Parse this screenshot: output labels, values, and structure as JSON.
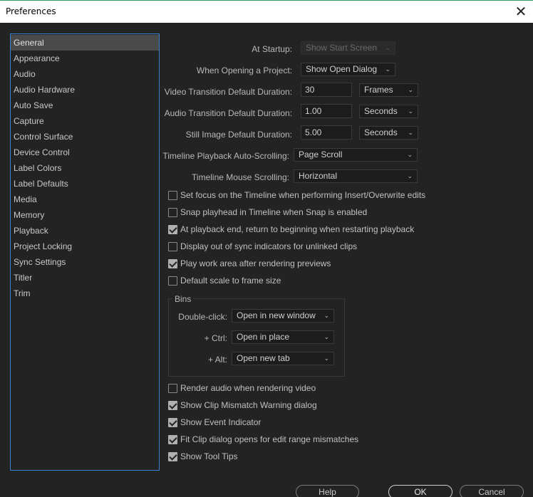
{
  "window": {
    "title": "Preferences",
    "close_glyph": "✕"
  },
  "sidebar": {
    "items": [
      {
        "label": "General",
        "selected": true
      },
      {
        "label": "Appearance"
      },
      {
        "label": "Audio"
      },
      {
        "label": "Audio Hardware"
      },
      {
        "label": "Auto Save"
      },
      {
        "label": "Capture"
      },
      {
        "label": "Control Surface"
      },
      {
        "label": "Device Control"
      },
      {
        "label": "Label Colors"
      },
      {
        "label": "Label Defaults"
      },
      {
        "label": "Media"
      },
      {
        "label": "Memory"
      },
      {
        "label": "Playback"
      },
      {
        "label": "Project Locking"
      },
      {
        "label": "Sync Settings"
      },
      {
        "label": "Titler"
      },
      {
        "label": "Trim"
      }
    ]
  },
  "general": {
    "at_startup": {
      "label": "At Startup:",
      "value": "Show Start Screen",
      "disabled": true
    },
    "when_opening": {
      "label": "When Opening a Project:",
      "value": "Show Open Dialog"
    },
    "video_transition": {
      "label": "Video Transition Default Duration:",
      "value": "30",
      "unit": "Frames"
    },
    "audio_transition": {
      "label": "Audio Transition Default Duration:",
      "value": "1.00",
      "unit": "Seconds"
    },
    "still_image": {
      "label": "Still Image Default Duration:",
      "value": "5.00",
      "unit": "Seconds"
    },
    "playback_autoscroll": {
      "label": "Timeline Playback Auto-Scrolling:",
      "value": "Page Scroll"
    },
    "mouse_scrolling": {
      "label": "Timeline Mouse Scrolling:",
      "value": "Horizontal"
    },
    "checkboxes_top": [
      {
        "label": "Set focus on the Timeline when performing Insert/Overwrite edits",
        "checked": false
      },
      {
        "label": "Snap playhead in Timeline when Snap is enabled",
        "checked": false
      },
      {
        "label": "At playback end, return to beginning when restarting playback",
        "checked": true
      },
      {
        "label": "Display out of sync indicators for unlinked clips",
        "checked": false
      },
      {
        "label": "Play work area after rendering previews",
        "checked": true
      },
      {
        "label": "Default scale to frame size",
        "checked": false
      }
    ],
    "bins": {
      "legend": "Bins",
      "double_click": {
        "label": "Double-click:",
        "value": "Open in new window"
      },
      "ctrl": {
        "label": "+ Ctrl:",
        "value": "Open in place"
      },
      "alt": {
        "label": "+ Alt:",
        "value": "Open new tab"
      }
    },
    "checkboxes_bottom": [
      {
        "label": "Render audio when rendering video",
        "checked": false
      },
      {
        "label": "Show Clip Mismatch Warning dialog",
        "checked": true
      },
      {
        "label": "Show Event Indicator",
        "checked": true
      },
      {
        "label": "Fit Clip dialog opens for edit range mismatches",
        "checked": true
      },
      {
        "label": "Show Tool Tips",
        "checked": true
      }
    ]
  },
  "buttons": {
    "help": "Help",
    "ok": "OK",
    "cancel": "Cancel"
  },
  "colors": {
    "background": "#232323",
    "selection": "#4a4a4a",
    "focus_border": "#3a7fd0"
  }
}
